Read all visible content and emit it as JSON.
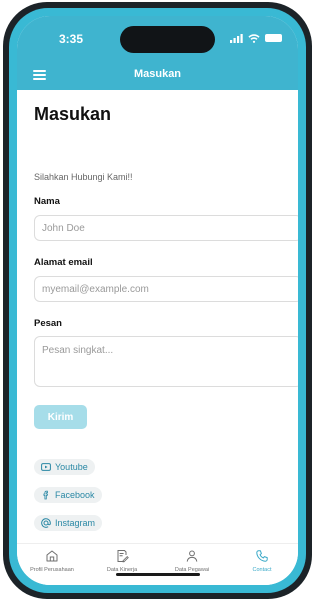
{
  "status_bar": {
    "time": "3:35"
  },
  "header": {
    "title": "Masukan"
  },
  "page": {
    "title": "Masukan",
    "subtitle": "Silahkan Hubungi Kami!!"
  },
  "form": {
    "name_label": "Nama",
    "name_placeholder": "John Doe",
    "email_label": "Alamat email",
    "email_placeholder": "myemail@example.com",
    "message_label": "Pesan",
    "message_placeholder": "Pesan singkat...",
    "submit_label": "Kirim"
  },
  "social": [
    {
      "label": "Youtube",
      "icon": "youtube-icon"
    },
    {
      "label": "Facebook",
      "icon": "facebook-icon"
    },
    {
      "label": "Instagram",
      "icon": "instagram-icon"
    }
  ],
  "bottom_nav": [
    {
      "label": "Profil Perusahaan",
      "icon": "home-icon",
      "active": false
    },
    {
      "label": "Data Kinerja",
      "icon": "document-edit-icon",
      "active": false
    },
    {
      "label": "Data Pegawai",
      "icon": "user-icon",
      "active": false
    },
    {
      "label": "Contact",
      "icon": "phone-icon",
      "active": true
    }
  ],
  "colors": {
    "accent": "#3fb4cf",
    "button_disabled": "#a6dde9",
    "active_nav": "#39a9c8",
    "link_text": "#2a88a5"
  }
}
